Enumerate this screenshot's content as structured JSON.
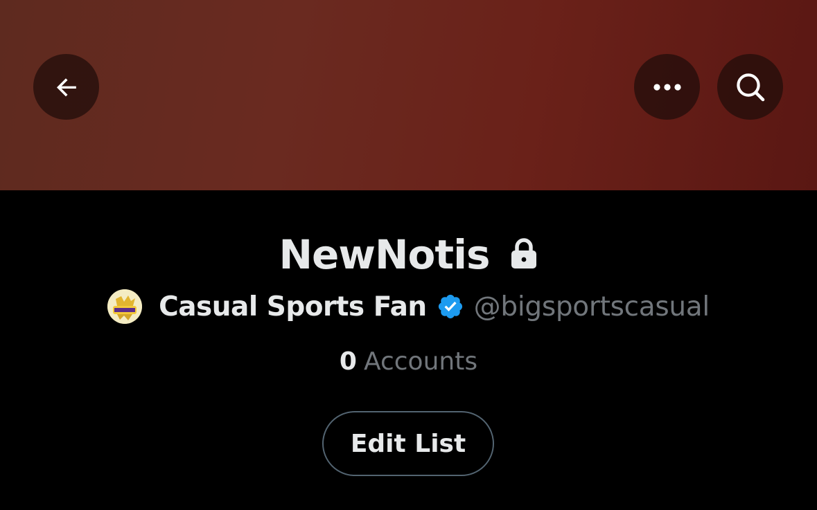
{
  "header": {
    "back_icon": "arrow-left-icon",
    "more_icon": "more-horizontal-icon",
    "search_icon": "search-icon",
    "banner_color": "#6a2a20"
  },
  "list": {
    "title": "NewNotis",
    "private_icon": "lock-icon",
    "owner": {
      "avatar_icon": "avatar-image",
      "name": "Casual Sports Fan",
      "verified_icon": "verified-badge-icon",
      "handle": "@bigsportscasual"
    },
    "member_count": "0",
    "member_label": "Accounts",
    "edit_label": "Edit List"
  },
  "colors": {
    "background": "#000000",
    "primary_text": "#e7e9ea",
    "secondary_text": "#71767b",
    "verified_blue": "#1d9bf0",
    "button_border": "#536471"
  }
}
